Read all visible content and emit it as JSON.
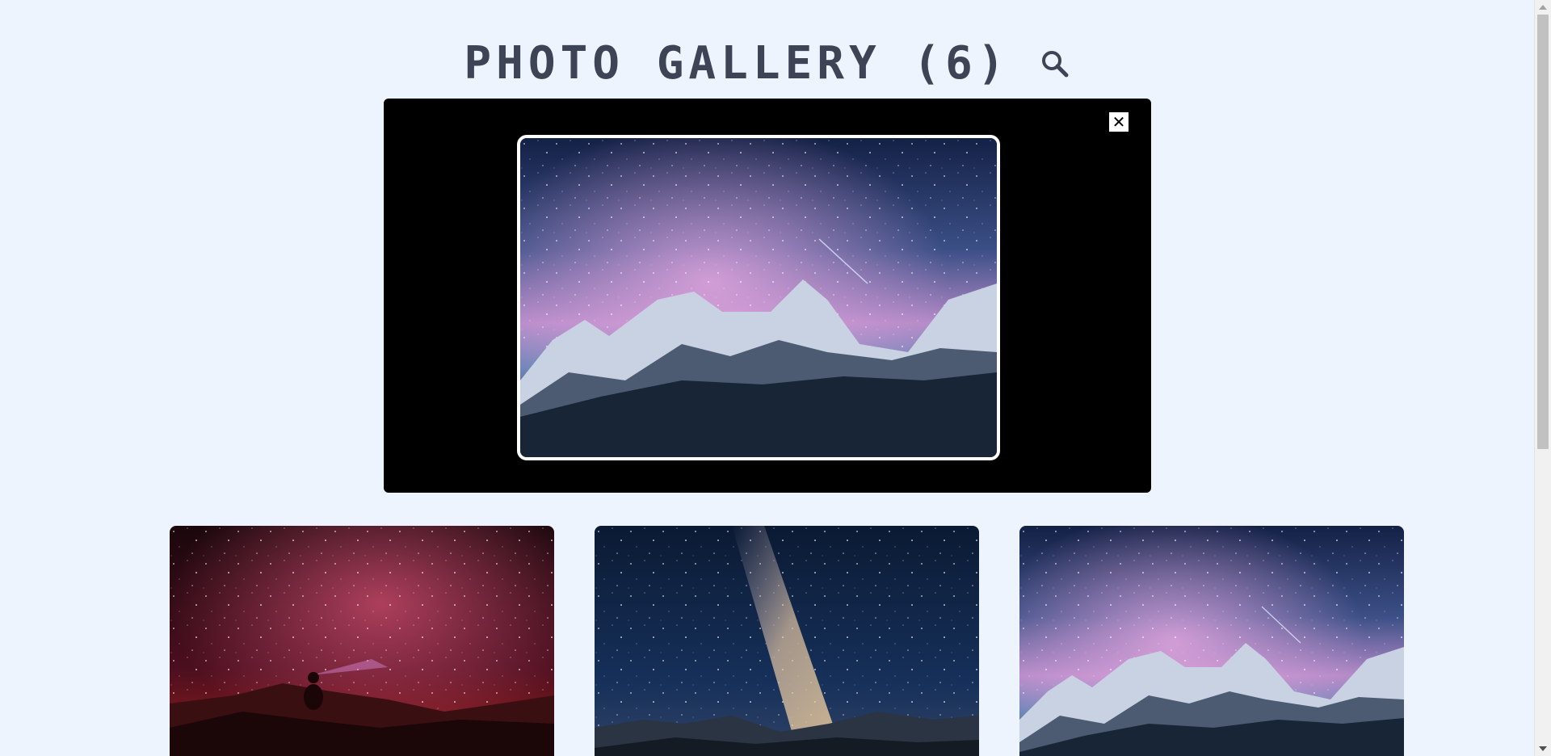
{
  "header": {
    "title": "PHOTO GALLERY (6)",
    "search_icon": "search-icon"
  },
  "modal": {
    "close_label": "✕",
    "close_icon": "close-icon",
    "image_icon": "snowy-mountains-milky-way-photo"
  },
  "gallery": {
    "items": [
      {
        "icon": "red-milky-way-headlamp-photo"
      },
      {
        "icon": "milky-way-over-mountains-photo"
      },
      {
        "icon": "snowy-mountains-milky-way-photo"
      }
    ]
  },
  "colors": {
    "background": "#eef4fd",
    "title": "#3d4455",
    "modal_bg": "#000000"
  }
}
